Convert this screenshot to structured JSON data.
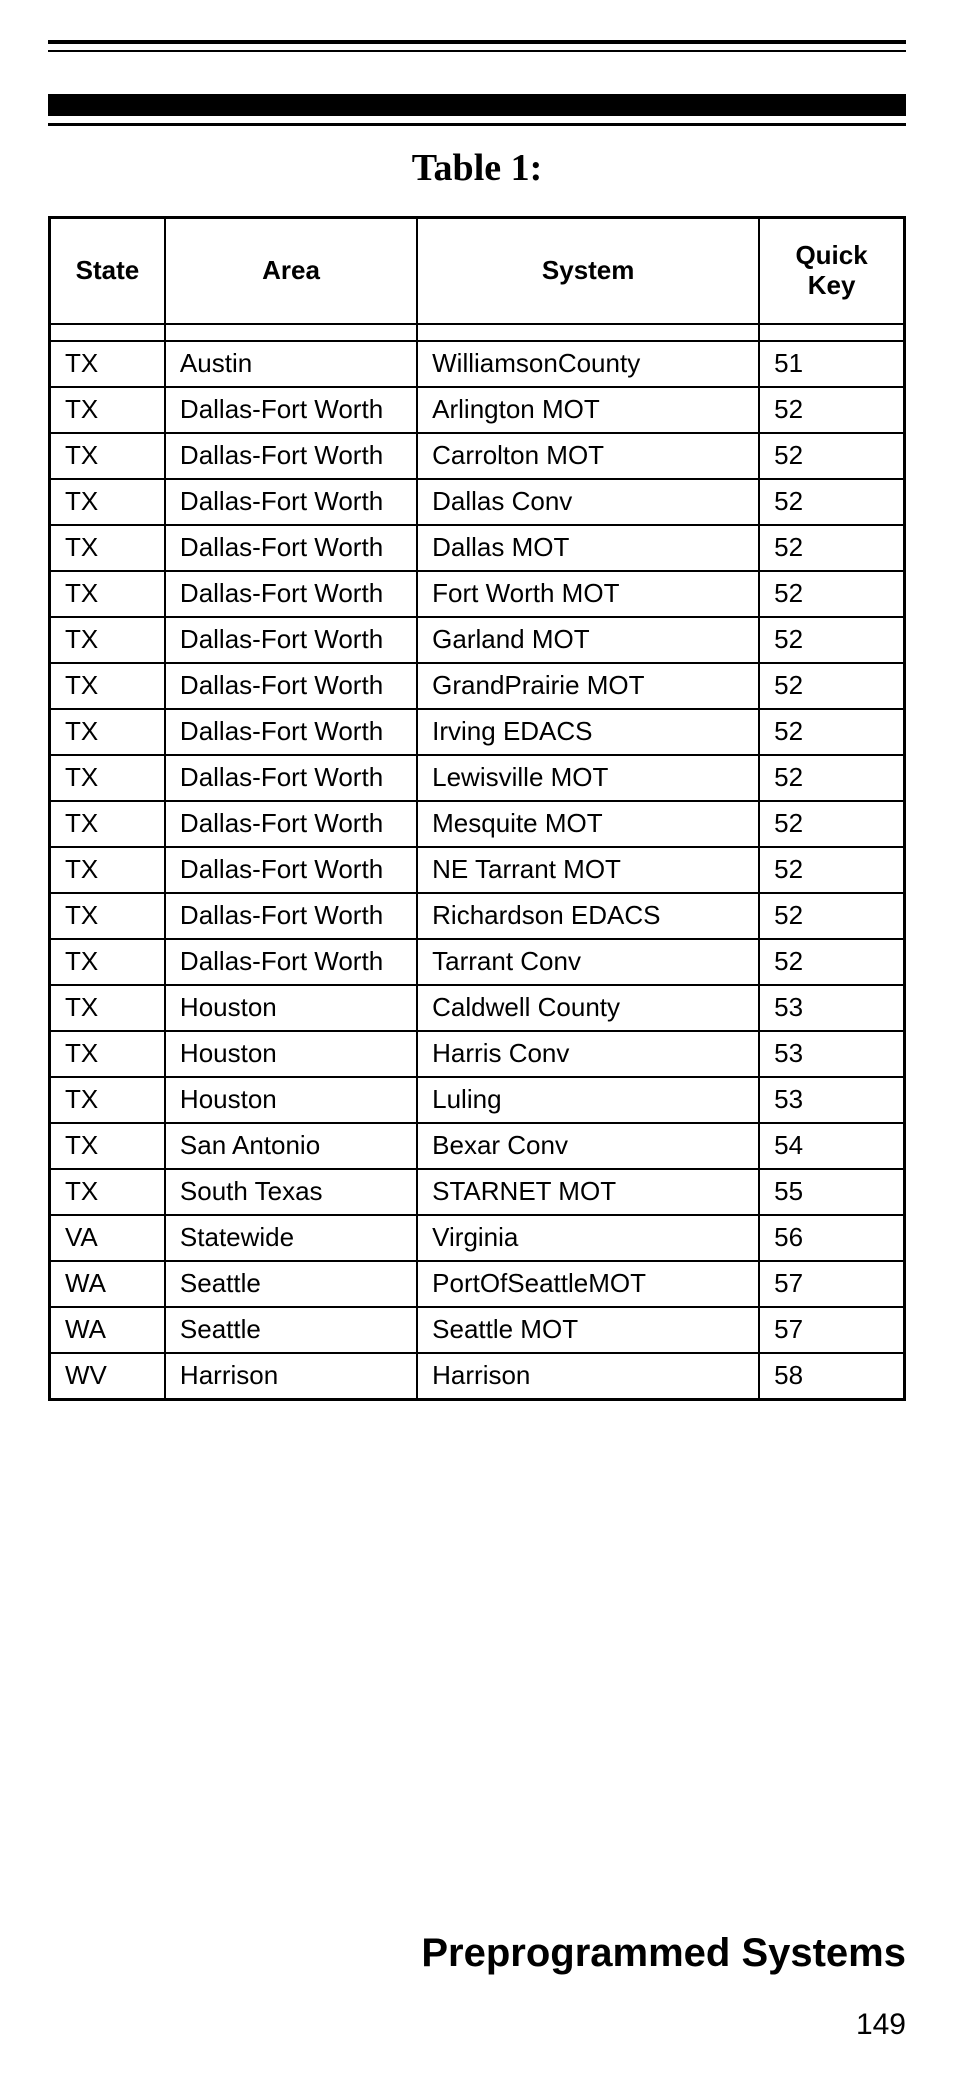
{
  "caption": "Table 1:",
  "headers": {
    "state": "State",
    "area": "Area",
    "system": "System",
    "key": "Quick\nKey"
  },
  "rows": [
    {
      "state": "TX",
      "area": "Austin",
      "system": "WilliamsonCounty",
      "key": "51"
    },
    {
      "state": "TX",
      "area": "Dallas-Fort Worth",
      "system": "Arlington MOT",
      "key": "52"
    },
    {
      "state": "TX",
      "area": "Dallas-Fort Worth",
      "system": "Carrolton MOT",
      "key": "52"
    },
    {
      "state": "TX",
      "area": "Dallas-Fort Worth",
      "system": "Dallas Conv",
      "key": "52"
    },
    {
      "state": "TX",
      "area": "Dallas-Fort Worth",
      "system": "Dallas MOT",
      "key": "52"
    },
    {
      "state": "TX",
      "area": "Dallas-Fort Worth",
      "system": "Fort Worth MOT",
      "key": "52"
    },
    {
      "state": "TX",
      "area": "Dallas-Fort Worth",
      "system": "Garland MOT",
      "key": "52"
    },
    {
      "state": "TX",
      "area": "Dallas-Fort Worth",
      "system": "GrandPrairie MOT",
      "key": "52"
    },
    {
      "state": "TX",
      "area": "Dallas-Fort Worth",
      "system": "Irving EDACS",
      "key": "52"
    },
    {
      "state": "TX",
      "area": "Dallas-Fort Worth",
      "system": "Lewisville MOT",
      "key": "52"
    },
    {
      "state": "TX",
      "area": "Dallas-Fort Worth",
      "system": "Mesquite MOT",
      "key": "52"
    },
    {
      "state": "TX",
      "area": "Dallas-Fort Worth",
      "system": "NE Tarrant MOT",
      "key": "52"
    },
    {
      "state": "TX",
      "area": "Dallas-Fort Worth",
      "system": "Richardson EDACS",
      "key": "52"
    },
    {
      "state": "TX",
      "area": "Dallas-Fort Worth",
      "system": "Tarrant Conv",
      "key": "52"
    },
    {
      "state": "TX",
      "area": "Houston",
      "system": "Caldwell County",
      "key": "53"
    },
    {
      "state": "TX",
      "area": "Houston",
      "system": "Harris Conv",
      "key": "53"
    },
    {
      "state": "TX",
      "area": "Houston",
      "system": "Luling",
      "key": "53"
    },
    {
      "state": "TX",
      "area": "San Antonio",
      "system": "Bexar Conv",
      "key": "54"
    },
    {
      "state": "TX",
      "area": "South Texas",
      "system": "STARNET MOT",
      "key": "55"
    },
    {
      "state": "VA",
      "area": "Statewide",
      "system": "Virginia",
      "key": "56"
    },
    {
      "state": "WA",
      "area": "Seattle",
      "system": "PortOfSeattleMOT",
      "key": "57"
    },
    {
      "state": "WA",
      "area": "Seattle",
      "system": "Seattle MOT",
      "key": "57"
    },
    {
      "state": "WV",
      "area": "Harrison",
      "system": "Harrison",
      "key": "58"
    }
  ],
  "section_title": "Preprogrammed Systems",
  "page_number": "149"
}
